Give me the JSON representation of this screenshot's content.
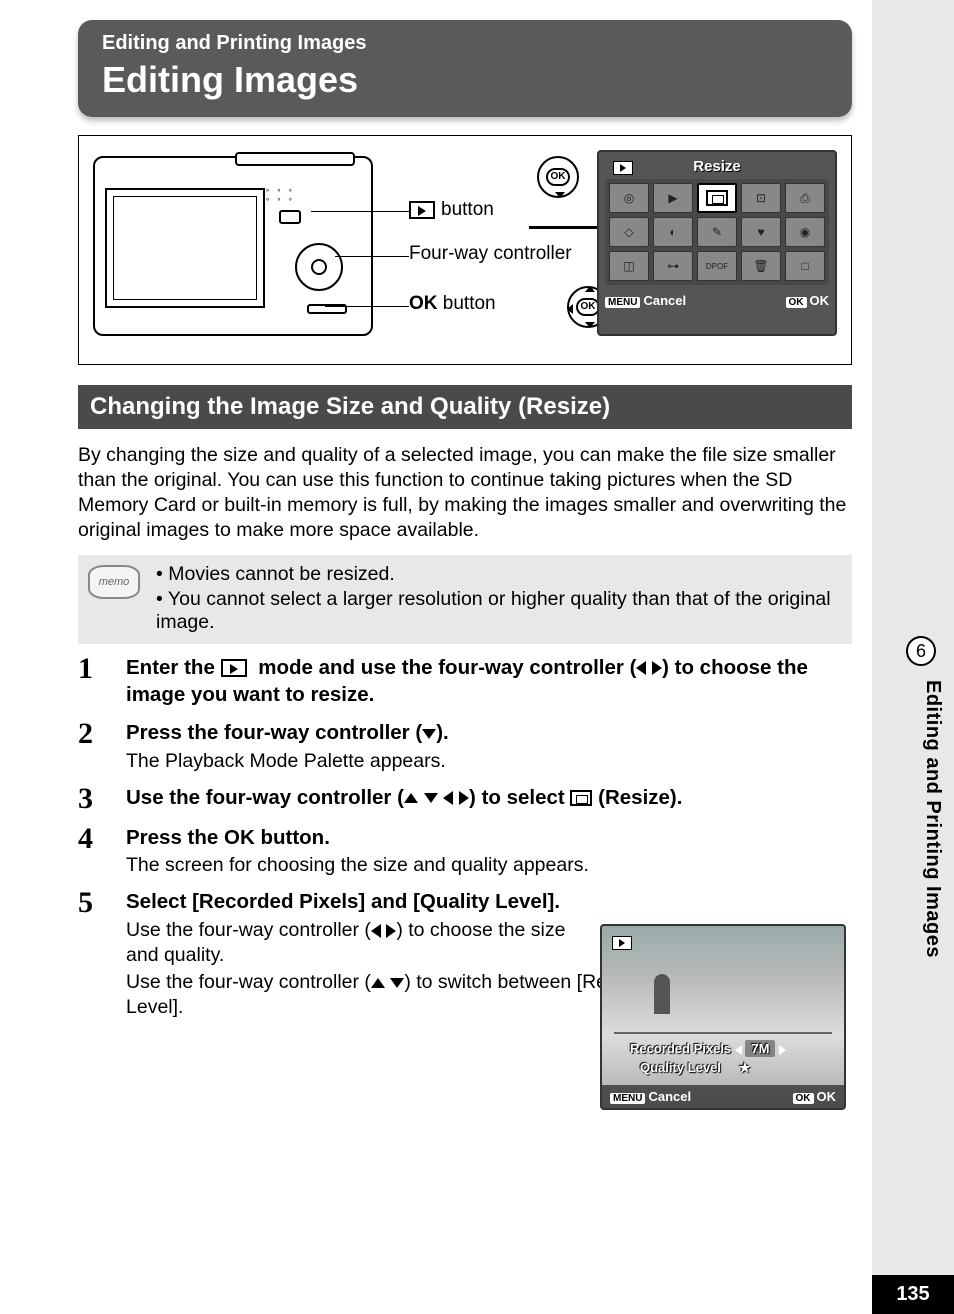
{
  "header": {
    "breadcrumb": "Editing and Printing Images",
    "title": "Editing Images"
  },
  "diagram": {
    "play_button_label": "button",
    "controller_label": "Four-way controller",
    "ok_button_label": "button",
    "ok_text": "OK",
    "ok_inner": "OK"
  },
  "lcd_palette": {
    "title": "Resize",
    "cancel_badge": "MENU",
    "cancel_text": "Cancel",
    "ok_badge": "OK",
    "ok_text": "OK"
  },
  "section_heading": "Changing the Image Size and Quality (Resize)",
  "intro_text": "By changing the size and quality of a selected image, you can make the file size smaller than the original. You can use this function to continue taking pictures when the SD Memory Card or built-in memory is full, by making the images smaller and overwriting the original images to make more space available.",
  "memo": {
    "label": "memo",
    "items": [
      "Movies cannot be resized.",
      "You cannot select a larger resolution or higher quality than that of the original image."
    ]
  },
  "steps": [
    {
      "num": "1",
      "title_pre": "Enter the ",
      "title_post": " mode and use the four-way controller (",
      "title_end": ") to choose the image you want to resize."
    },
    {
      "num": "2",
      "title": "Press the four-way controller (",
      "title_end": ").",
      "desc": "The Playback Mode Palette appears."
    },
    {
      "num": "3",
      "title": "Use the four-way controller (",
      "title_mid": ") to select ",
      "title_end": " (Resize)."
    },
    {
      "num": "4",
      "title_pre": "Press the ",
      "title_ok": "OK",
      "title_post": " button.",
      "desc": "The screen for choosing the size and quality appears."
    },
    {
      "num": "5",
      "title": "Select [Recorded Pixels] and [Quality Level].",
      "desc1_pre": "Use the four-way controller (",
      "desc1_post": ") to choose the size and quality.",
      "desc2_pre": "Use the four-way controller (",
      "desc2_post": ") to switch between [Recorded Pixels] and [Quality Level]."
    }
  ],
  "step_screen": {
    "recorded_pixels_label": "Recorded Pixels",
    "recorded_pixels_value": "7M",
    "quality_label": "Quality Level",
    "quality_value": "★",
    "cancel_badge": "MENU",
    "cancel_text": "Cancel",
    "ok_badge": "OK",
    "ok_text": "OK"
  },
  "side": {
    "chapter_num": "6",
    "chapter_title": "Editing and Printing Images"
  },
  "page_number": "135"
}
